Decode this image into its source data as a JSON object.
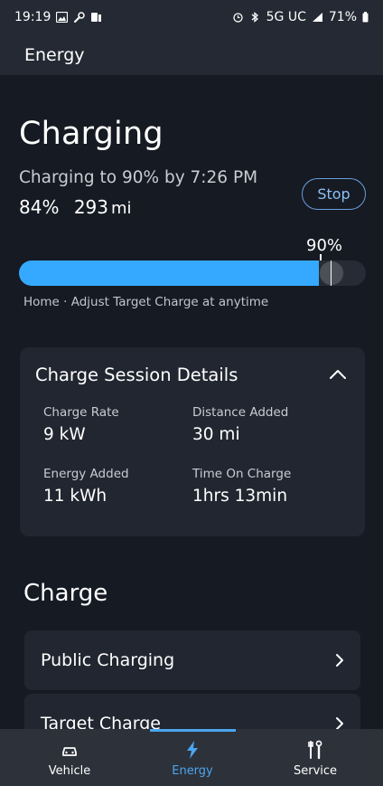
{
  "status_bar": {
    "time": "19:19",
    "network": "5G UC",
    "battery": "71%"
  },
  "app_bar": {
    "title": "Energy"
  },
  "charging": {
    "title": "Charging",
    "subtitle": "Charging to 90% by 7:26 PM",
    "charge_percent": "84%",
    "range_value": "293",
    "range_unit": "mi",
    "stop_label": "Stop",
    "target_label": "90%",
    "current_level": 0.84,
    "target_level": 0.9,
    "hint": "Home · Adjust Target Charge at anytime"
  },
  "session": {
    "title": "Charge Session Details",
    "items": [
      {
        "label": "Charge Rate",
        "value": "9 kW"
      },
      {
        "label": "Distance Added",
        "value": "30 mi"
      },
      {
        "label": "Energy Added",
        "value": "11 kWh"
      },
      {
        "label": "Time On Charge",
        "value": "1hrs 13min"
      }
    ]
  },
  "charge_section": {
    "title": "Charge",
    "rows": [
      {
        "label": "Public Charging"
      },
      {
        "label": "Target Charge"
      }
    ]
  },
  "bottom_nav": {
    "items": [
      {
        "label": "Vehicle",
        "icon": "car-icon"
      },
      {
        "label": "Energy",
        "icon": "lightning-bolt-icon",
        "active": true
      },
      {
        "label": "Service",
        "icon": "tools-icon"
      }
    ],
    "active_color": "#4aa6f0",
    "inactive_color": "#ffffff"
  },
  "colors": {
    "accent": "#35a9ff",
    "background": "#161a23",
    "card": "#222630"
  }
}
